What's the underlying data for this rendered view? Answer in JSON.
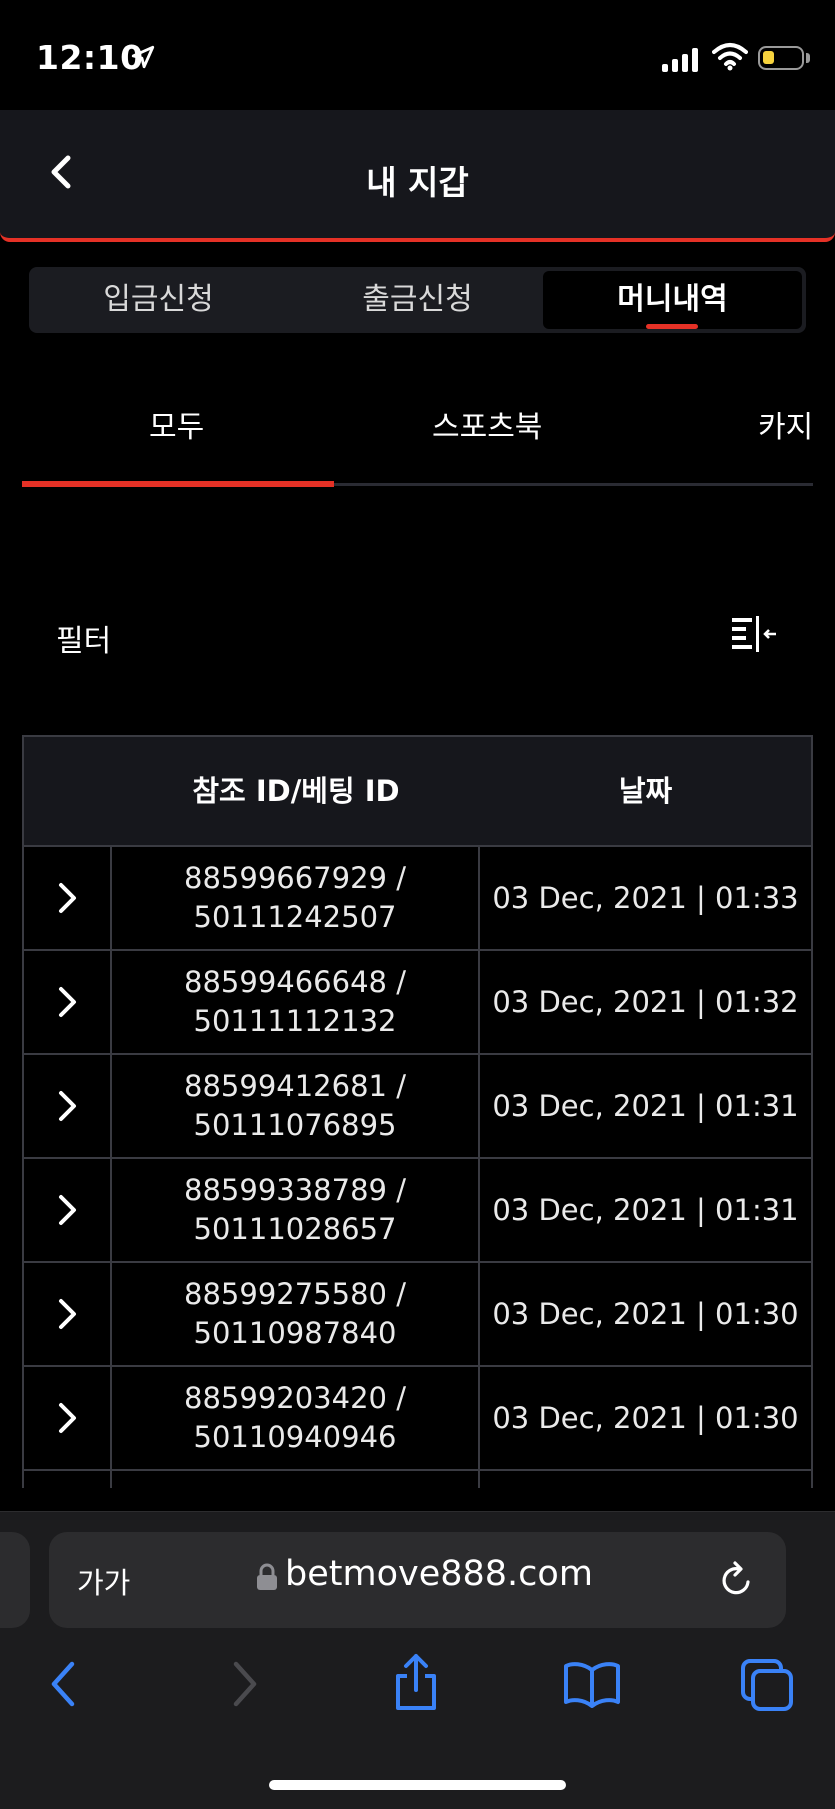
{
  "status_bar": {
    "time": "12:10"
  },
  "header": {
    "title": "내 지갑"
  },
  "segments": [
    {
      "label": "입금신청",
      "active": false
    },
    {
      "label": "출금신청",
      "active": false
    },
    {
      "label": "머니내역",
      "active": true
    }
  ],
  "categories": [
    {
      "label": "모두",
      "active": true
    },
    {
      "label": "스포츠북",
      "active": false
    },
    {
      "label": "카지",
      "active": false
    }
  ],
  "filter": {
    "label": "필터",
    "icon": "filter-icon"
  },
  "table": {
    "headers": [
      "",
      "참조 ID/베팅 ID",
      "날짜"
    ],
    "rows": [
      {
        "ref_id": "88599667929 /",
        "bet_id": "50111242507",
        "date": "03 Dec, 2021 | 01:33"
      },
      {
        "ref_id": "88599466648 /",
        "bet_id": "50111112132",
        "date": "03 Dec, 2021 | 01:32"
      },
      {
        "ref_id": "88599412681 /",
        "bet_id": "50111076895",
        "date": "03 Dec, 2021 | 01:31"
      },
      {
        "ref_id": "88599338789 /",
        "bet_id": "50111028657",
        "date": "03 Dec, 2021 | 01:31"
      },
      {
        "ref_id": "88599275580 /",
        "bet_id": "50110987840",
        "date": "03 Dec, 2021 | 01:30"
      },
      {
        "ref_id": "88599203420 /",
        "bet_id": "50110940946",
        "date": "03 Dec, 2021 | 01:30"
      }
    ]
  },
  "browser": {
    "text_size_label": "가가",
    "url": "betmove888.com"
  },
  "colors": {
    "accent": "#e53126",
    "background": "#000000",
    "panel": "#16171c",
    "link_blue": "#3a82f7"
  }
}
